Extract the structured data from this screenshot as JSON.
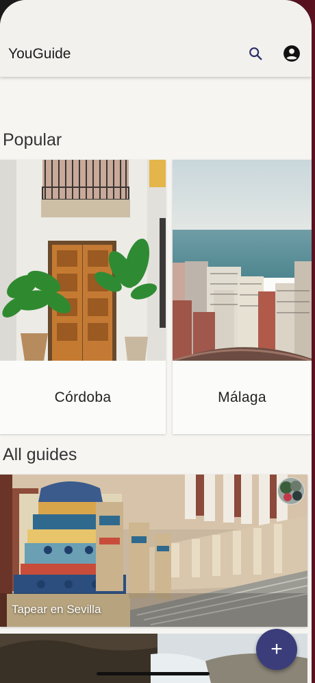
{
  "app": {
    "title": "YouGuide"
  },
  "header": {
    "search_icon": "search-icon",
    "account_icon": "account-circle-icon"
  },
  "sections": {
    "popular": {
      "title": "Popular"
    },
    "all_guides": {
      "title": "All guides"
    }
  },
  "popular_cards": [
    {
      "name": "Córdoba",
      "image": "whitewashed-patio-wooden-door-plants"
    },
    {
      "name": "Málaga",
      "image": "coastal-city-skyline-sea"
    }
  ],
  "guides": [
    {
      "title": "Tapear en Sevilla",
      "image": "plaza-de-espana-tiled-balustrade"
    }
  ],
  "fab": {
    "label": "+",
    "icon": "add-icon"
  },
  "colors": {
    "accent": "#3b3d7a",
    "background": "#f6f5f2",
    "appbar": "#f2f1ee"
  }
}
